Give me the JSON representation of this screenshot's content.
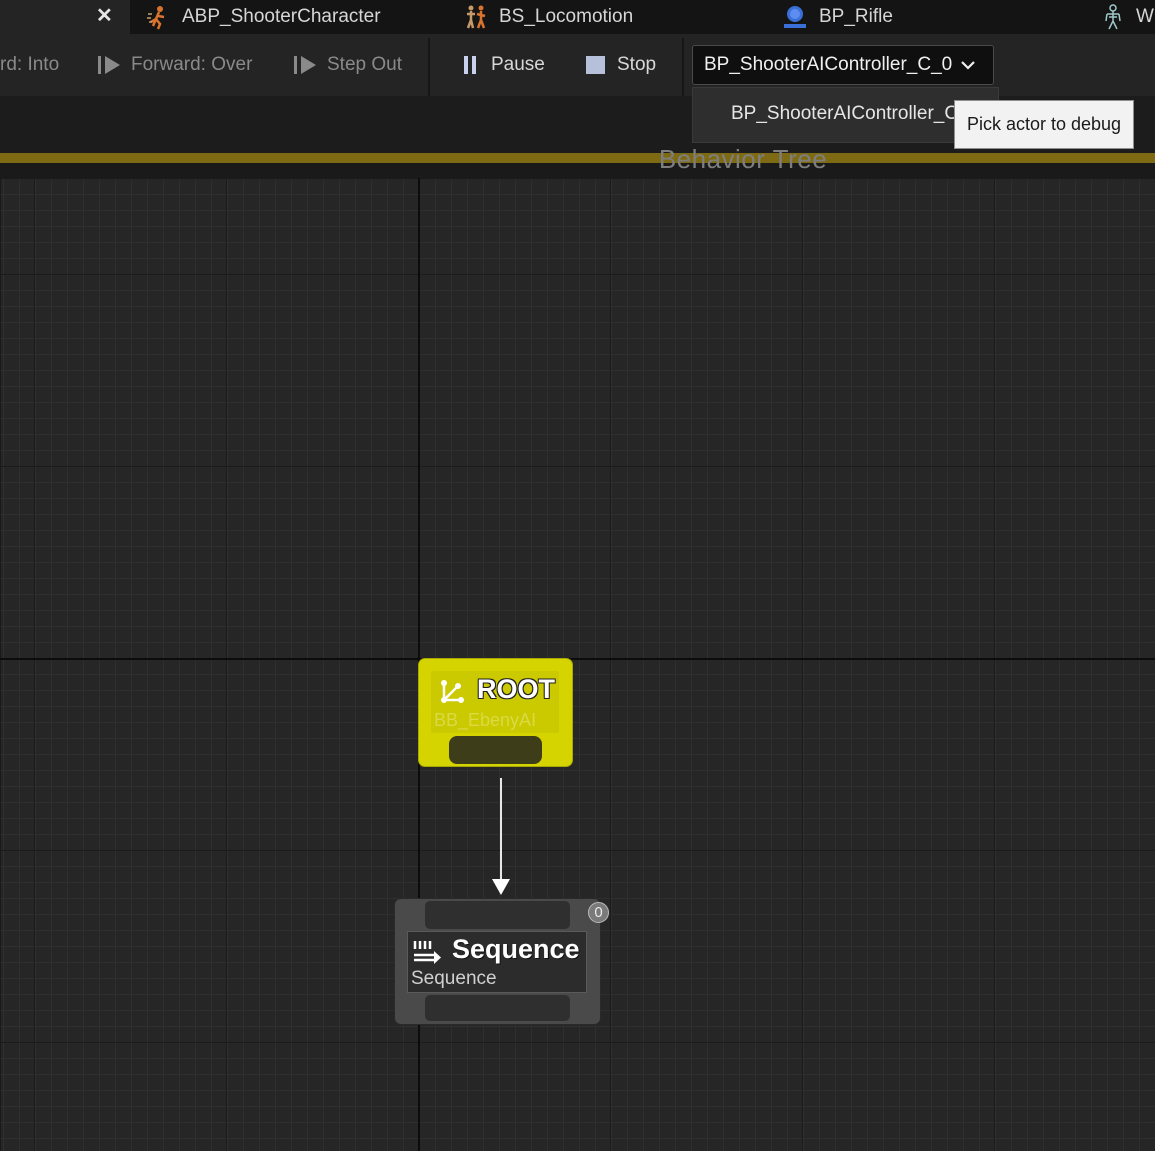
{
  "tabs": [
    {
      "label": "ABP_ShooterCharacter",
      "icon": "animation-blueprint-icon"
    },
    {
      "label": "BS_Locomotion",
      "icon": "blendspace-icon"
    },
    {
      "label": "BP_Rifle",
      "icon": "blueprint-actor-icon"
    },
    {
      "label": "W",
      "icon": "skeleton-icon"
    }
  ],
  "toolbar": {
    "step_into": "rd: Into",
    "step_over": "Forward: Over",
    "step_out": "Step Out",
    "pause": "Pause",
    "stop": "Stop",
    "debug_actor": "BP_ShooterAIController_C_0"
  },
  "dropdown": {
    "option": "BP_ShooterAIController_C_0",
    "tooltip": "Pick actor to debug"
  },
  "graph": {
    "title": "Behavior Tree"
  },
  "nodes": {
    "root": {
      "title": "ROOT",
      "subtitle": "BB_EbenyAI"
    },
    "sequence": {
      "title": "Sequence",
      "subtitle": "Sequence",
      "index": "0"
    }
  },
  "colors": {
    "root_node": "#d6d400",
    "title_bar": "#7d6a12",
    "tooltip_bg": "#f2f2f2"
  }
}
